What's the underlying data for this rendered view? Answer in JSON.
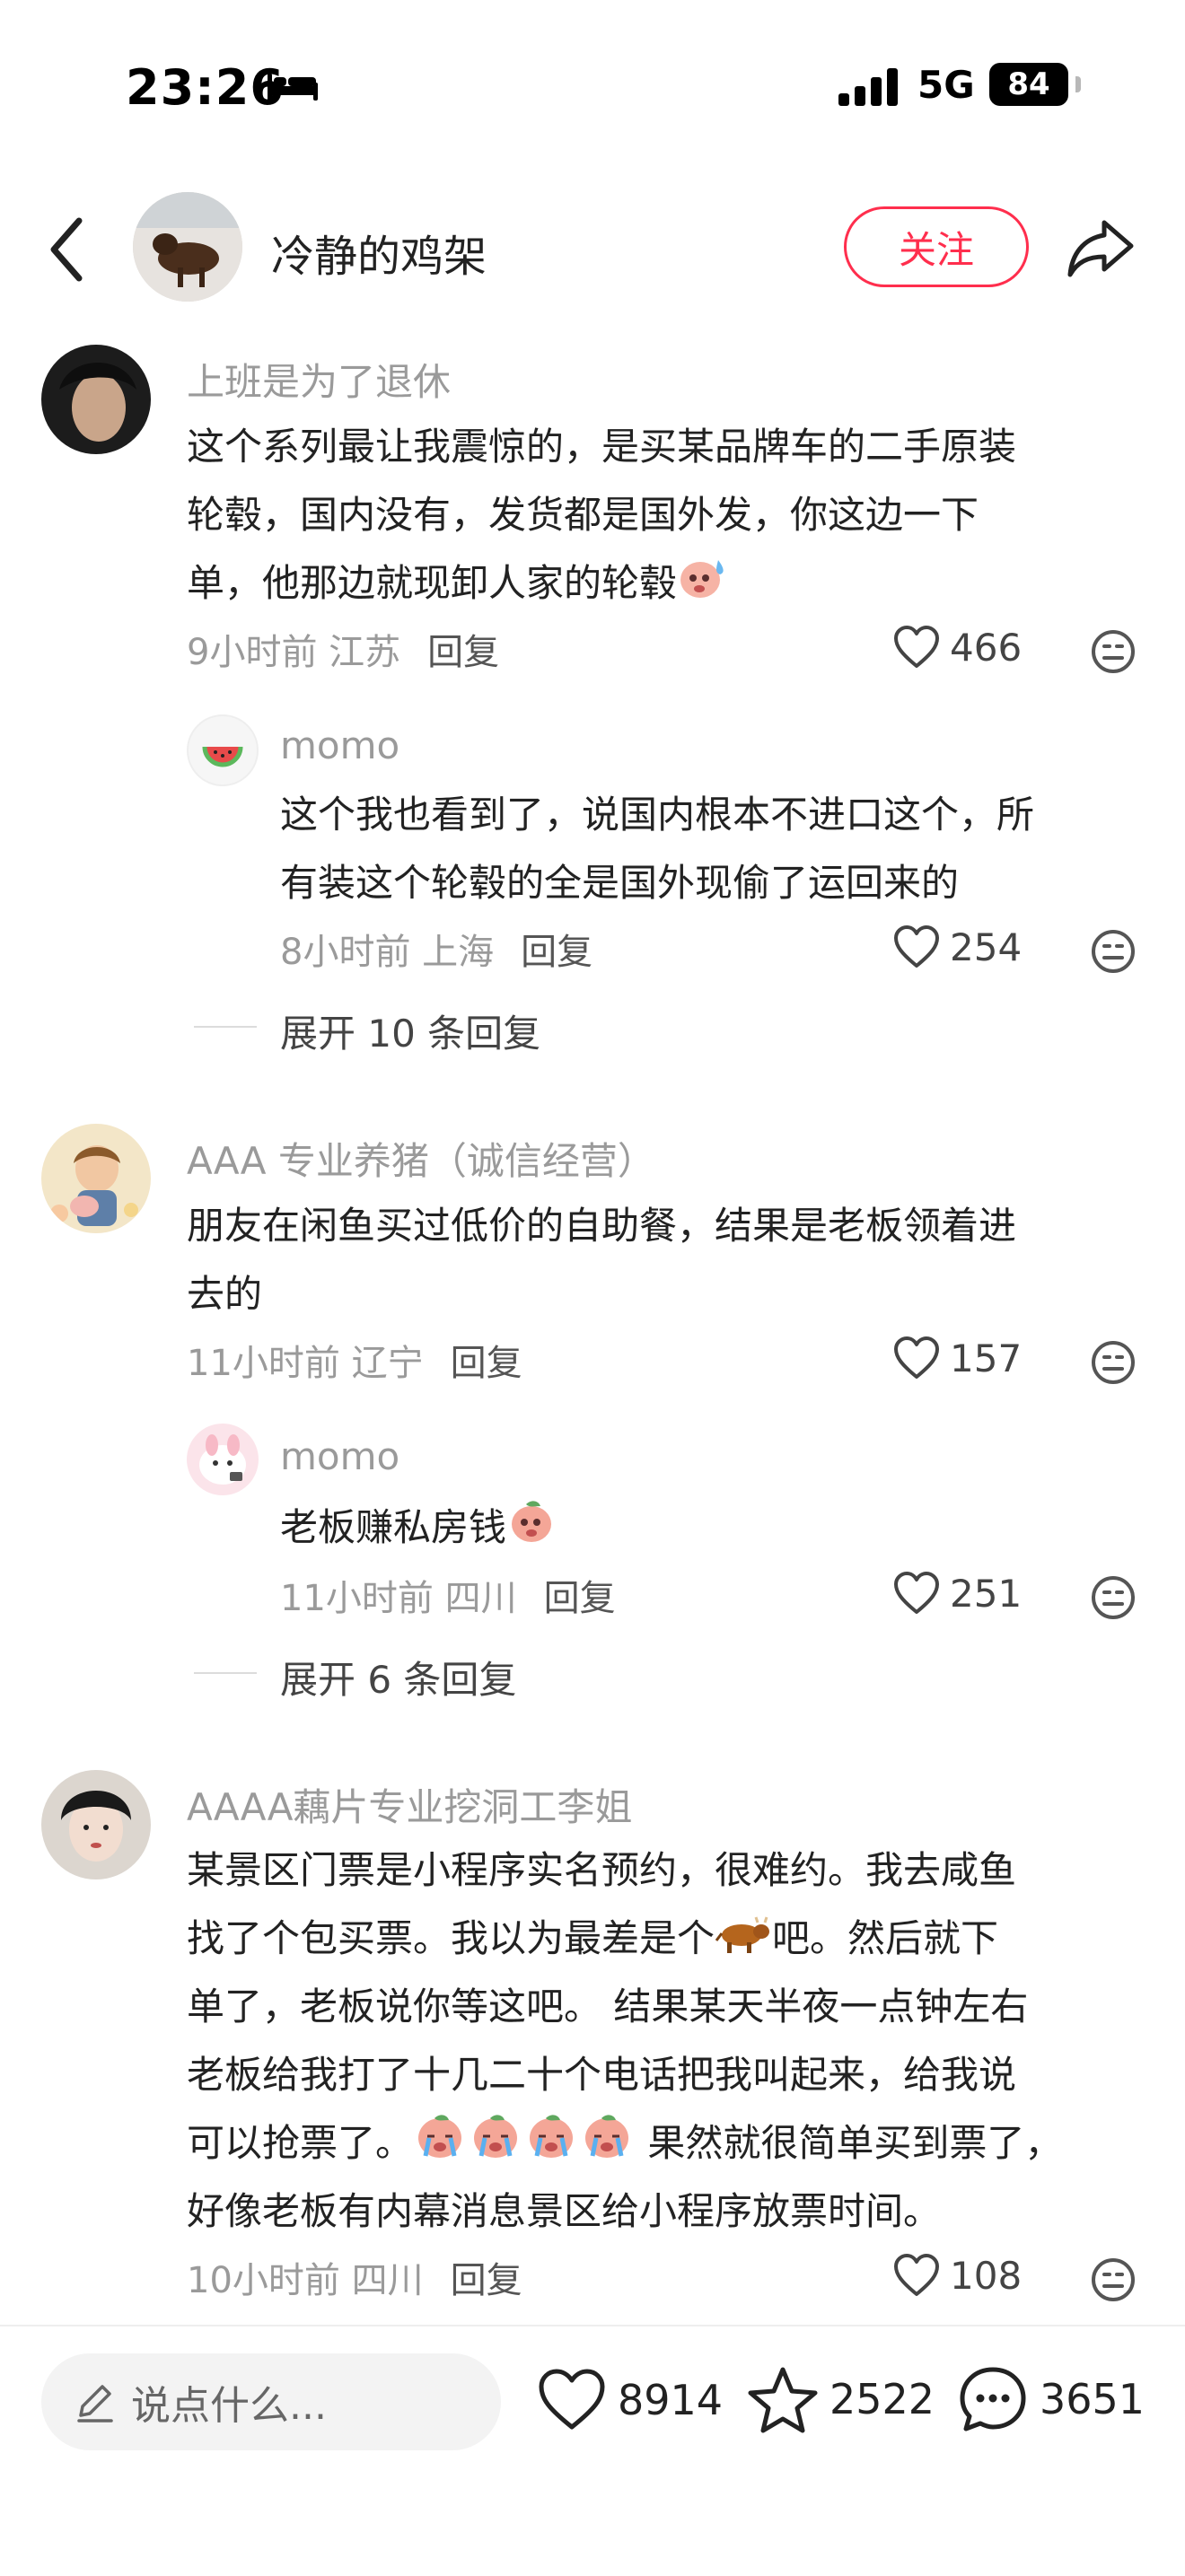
{
  "status_bar": {
    "time": "23:26",
    "network": "5G",
    "battery": "84"
  },
  "header": {
    "author_name": "冷静的鸡架",
    "follow_label": "关注"
  },
  "comments": [
    {
      "user": "上班是为了退休",
      "text": [
        "这个系列最让我震惊的，是买某品牌车的二手原装",
        "轮毂，国内没有，发货都是国外发，你这边一下",
        "单，他那边就现卸人家的轮毂"
      ],
      "time": "9小时前",
      "location": "江苏",
      "reply_label": "回复",
      "likes": "466",
      "replies": [
        {
          "user": "momo",
          "text": [
            "这个我也看到了，说国内根本不进口这个，所",
            "有装这个轮毂的全是国外现偷了运回来的"
          ],
          "time": "8小时前",
          "location": "上海",
          "reply_label": "回复",
          "likes": "254"
        }
      ],
      "expand_label": "展开 10 条回复"
    },
    {
      "user": "AAA 专业养猪（诚信经营）",
      "text": [
        "朋友在闲鱼买过低价的自助餐，结果是老板领着进",
        "去的"
      ],
      "time": "11小时前",
      "location": "辽宁",
      "reply_label": "回复",
      "likes": "157",
      "replies": [
        {
          "user": "momo",
          "text": [
            "老板赚私房钱"
          ],
          "time": "11小时前",
          "location": "四川",
          "reply_label": "回复",
          "likes": "251"
        }
      ],
      "expand_label": "展开 6 条回复"
    },
    {
      "user": "AAAA藕片专业挖洞工李姐",
      "text": [
        "某景区门票是小程序实名预约，很难约。我去咸鱼",
        "找了个包买票。我以为最差是个",
        "吧。然后就下",
        "单了，老板说你等这吧。 结果某天半夜一点钟左右",
        "老板给我打了十几二十个电话把我叫起来，给我说",
        "可以抢票了。",
        "果然就很简单买到票了，",
        "好像老板有内幕消息景区给小程序放票时间。"
      ],
      "time": "10小时前",
      "location": "四川",
      "reply_label": "回复",
      "likes": "108"
    }
  ],
  "bottom_bar": {
    "input_placeholder": "说点什么...",
    "likes": "8914",
    "favorites": "2522",
    "comments": "3651"
  },
  "colors": {
    "accent": "#ff2e4d",
    "muted_text": "#9a9a9a"
  },
  "icons": [
    "back-arrow-icon",
    "share-icon",
    "heart-icon",
    "dislike-face-icon",
    "pencil-icon",
    "star-icon",
    "comment-bubble-icon",
    "bed-icon",
    "signal-icon",
    "battery-icon"
  ]
}
